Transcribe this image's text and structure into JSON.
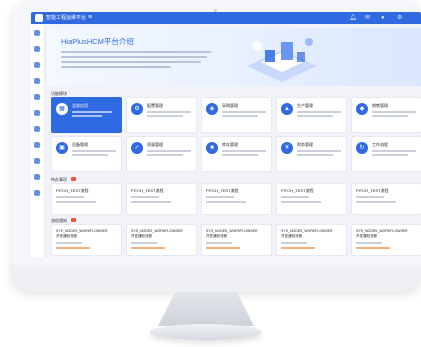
{
  "app": {
    "title": "智能工程运维平台",
    "menu_icon": "menu-icon",
    "top_icons": [
      "bell-icon",
      "mail-icon",
      "user-icon",
      "settings-icon"
    ]
  },
  "hero": {
    "title": "HiaPlusHCM平台介绍"
  },
  "sections": {
    "modules": "功能模块",
    "todos": "待办事项",
    "notices": "流程通知"
  },
  "modules": [
    {
      "name": "全部应用",
      "icon": "grid-icon",
      "active": true
    },
    {
      "name": "配置管理",
      "icon": "config-icon",
      "active": false
    },
    {
      "name": "采购管理",
      "icon": "cart-icon",
      "active": false
    },
    {
      "name": "生产管理",
      "icon": "factory-icon",
      "active": false
    },
    {
      "name": "销售管理",
      "icon": "sales-icon",
      "active": false
    },
    {
      "name": "设备管理",
      "icon": "device-icon",
      "active": false
    },
    {
      "name": "质量管理",
      "icon": "quality-icon",
      "active": false
    },
    {
      "name": "库存管理",
      "icon": "stock-icon",
      "active": false
    },
    {
      "name": "财务管理",
      "icon": "finance-icon",
      "active": false
    },
    {
      "name": "工作流程",
      "icon": "flow-icon",
      "active": false
    }
  ],
  "todos": [
    {
      "title": "PITCH_TEST流程"
    },
    {
      "title": "PITCH_TEST流程"
    },
    {
      "title": "PITCH_TEST流程"
    },
    {
      "title": "PITCH_TEST流程"
    },
    {
      "title": "PITCH_TEST流程"
    }
  ],
  "notices": [
    {
      "title": "SYS_NODES_WORKFLOWSER",
      "sub": "开发通知流程"
    },
    {
      "title": "SYS_NODES_WORKFLOWSER",
      "sub": "开发通知流程"
    },
    {
      "title": "SYS_NODES_WORKFLOWSER",
      "sub": "开发通知流程"
    },
    {
      "title": "SYS_NODES_WORKFLOWSER",
      "sub": "开发通知流程"
    },
    {
      "title": "SYS_NODES_WORKFLOWSER",
      "sub": "开发通知流程"
    }
  ],
  "colors": {
    "accent": "#2f6ae0",
    "badge": "#f5533d",
    "warning": "#f08a24"
  }
}
